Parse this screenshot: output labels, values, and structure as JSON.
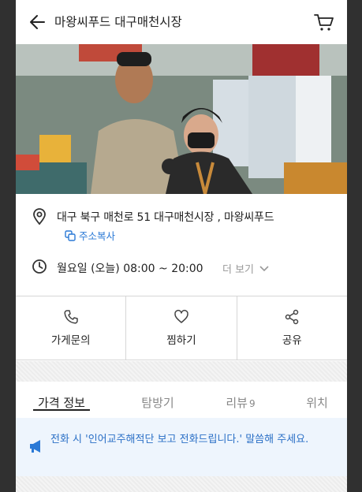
{
  "header": {
    "title": "마왕씨푸드 대구매천시장"
  },
  "store": {
    "address": "대구 북구 매천로 51 대구매천시장 , 마왕씨푸드",
    "copy_label": "주소복사",
    "hours": "월요일 (오늘) 08:00 ~ 20:00",
    "more_label": "더 보기"
  },
  "actions": [
    {
      "label": "가게문의",
      "icon": "phone-icon"
    },
    {
      "label": "찜하기",
      "icon": "heart-icon"
    },
    {
      "label": "공유",
      "icon": "share-icon"
    }
  ],
  "tabs": [
    {
      "label": "가격 정보",
      "count": "",
      "active": true
    },
    {
      "label": "탐방기",
      "count": "",
      "active": false
    },
    {
      "label": "리뷰",
      "count": "9",
      "active": false
    },
    {
      "label": "위치",
      "count": "",
      "active": false
    }
  ],
  "notice": {
    "text": "전화 시 '인어교주해적단 보고 전화드립니다.' 말씀해 주세요."
  },
  "colors": {
    "accent": "#2a79d6",
    "notice_bg": "#eef5fd",
    "notice_text": "#2a6fc6"
  }
}
